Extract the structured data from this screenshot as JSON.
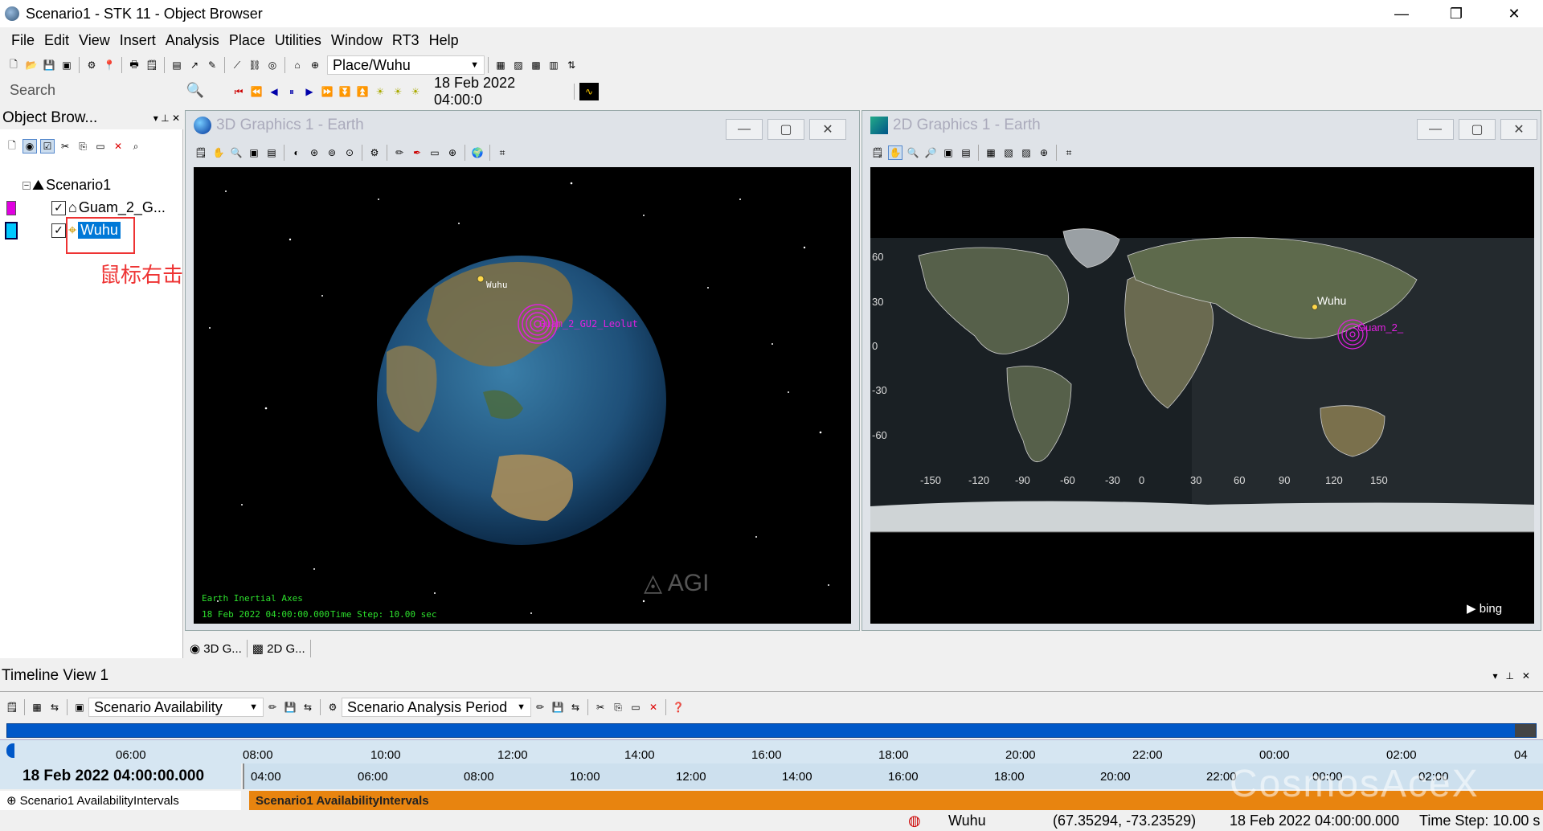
{
  "window": {
    "title": "Scenario1 - STK 11 - Object Browser",
    "minimize": "—",
    "maximize": "❐",
    "close": "✕"
  },
  "menu": [
    "File",
    "Edit",
    "View",
    "Insert",
    "Analysis",
    "Place",
    "Utilities",
    "Window",
    "RT3",
    "Help"
  ],
  "toolbar": {
    "object_combo": "Place/Wuhu",
    "time_display": "18 Feb 2022 04:00:0",
    "search_placeholder": "Search"
  },
  "object_browser": {
    "title": "Object Brow...",
    "root": "Scenario1",
    "items": [
      {
        "label": "Guam_2_G...",
        "color": "#e000e0",
        "checked": true
      },
      {
        "label": "Wuhu",
        "color": "#00c8ff",
        "checked": true,
        "selected": true
      }
    ],
    "annotation": "鼠标右击"
  },
  "graphics3d": {
    "title": "3D Graphics 1 - Earth",
    "labels": {
      "wuhu": "Wuhu",
      "guam": "Guam_2_GU2_Leolut"
    },
    "axes_label": "Earth Inertial Axes",
    "time_label": "18 Feb 2022 04:00:00.000",
    "step_label": "Time Step: 10.00 sec",
    "watermark": "AGI"
  },
  "graphics2d": {
    "title": "2D Graphics 1 - Earth",
    "lat_ticks": [
      "60",
      "30",
      "0",
      "-30",
      "-60"
    ],
    "lon_ticks": [
      "-150",
      "-120",
      "-90",
      "-60",
      "-30",
      "0",
      "30",
      "60",
      "90",
      "120",
      "150"
    ],
    "labels": {
      "wuhu": "Wuhu",
      "guam": "Guam_2_"
    },
    "bing": "bing"
  },
  "tabs": [
    "3D G...",
    "2D G..."
  ],
  "timeline": {
    "title": "Timeline View 1",
    "availability_combo": "Scenario Availability",
    "period_combo": "Scenario Analysis Period",
    "top_ticks": [
      "06:00",
      "08:00",
      "10:00",
      "12:00",
      "14:00",
      "16:00",
      "18:00",
      "20:00",
      "22:00",
      "00:00",
      "02:00",
      "04"
    ],
    "current_time": "18 Feb 2022 04:00:00.000",
    "lower_ticks": [
      "04:00",
      "06:00",
      "08:00",
      "10:00",
      "12:00",
      "14:00",
      "16:00",
      "18:00",
      "20:00",
      "22:00",
      "00:00",
      "02:00"
    ],
    "row_label": "Scenario1 AvailabilityIntervals",
    "bar_label": "Scenario1 AvailabilityIntervals"
  },
  "status": {
    "object": "Wuhu",
    "coords": "(67.35294, -73.23529)",
    "time": "18 Feb 2022 04:00:00.000",
    "step": "Time Step: 10.00 s",
    "watermark": "CosmosAceX"
  }
}
